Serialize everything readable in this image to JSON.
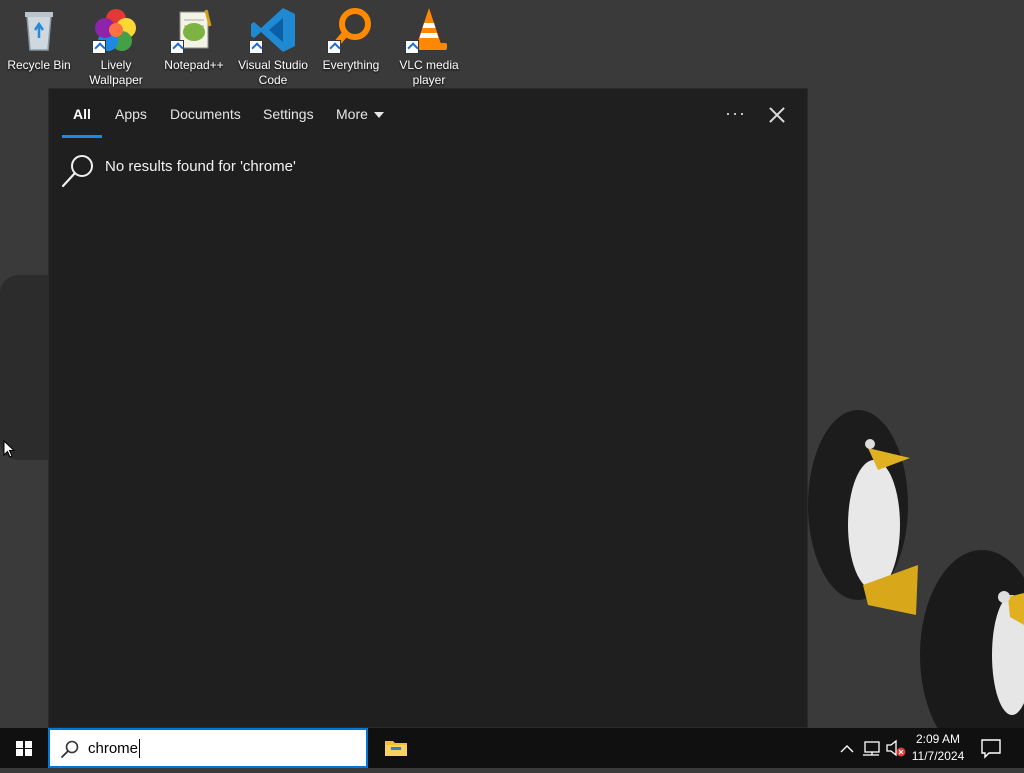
{
  "desktop": {
    "icons": [
      {
        "label": "Recycle Bin",
        "icon": "recycle-bin-icon"
      },
      {
        "label": "Lively Wallpaper",
        "icon": "lively-wallpaper-icon"
      },
      {
        "label": "Notepad++",
        "icon": "notepad-plus-plus-icon"
      },
      {
        "label": "Visual Studio Code",
        "icon": "vscode-icon"
      },
      {
        "label": "Everything",
        "icon": "everything-search-icon"
      },
      {
        "label": "VLC media player",
        "icon": "vlc-icon"
      }
    ]
  },
  "search_panel": {
    "tabs": [
      {
        "label": "All",
        "active": true
      },
      {
        "label": "Apps",
        "active": false
      },
      {
        "label": "Documents",
        "active": false
      },
      {
        "label": "Settings",
        "active": false
      },
      {
        "label": "More",
        "active": false
      }
    ],
    "more_options_label": "···",
    "no_results_text": "No results found for 'chrome'"
  },
  "taskbar": {
    "search_value": "chrome",
    "time": "2:09 AM",
    "date": "11/7/2024"
  },
  "colors": {
    "accent": "#1e88e5",
    "panel_bg": "#1f1f1f",
    "taskbar_bg": "#101010"
  }
}
